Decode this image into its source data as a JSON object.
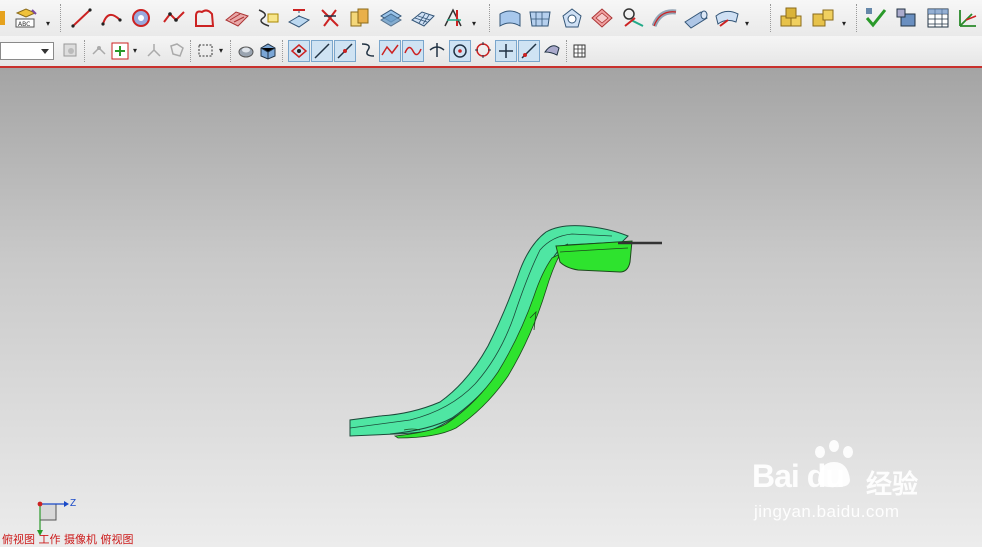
{
  "toolbar_top": {
    "groups": [
      {
        "icons": [
          "shade-icon",
          "text-style-icon"
        ]
      },
      {
        "icons": [
          "line-icon",
          "arc-icon",
          "circle-sweep-icon",
          "point-set-icon",
          "offset-curve-icon",
          "ruled-surface-icon",
          "section-curve-icon",
          "project-curve-icon",
          "bridge-curve-icon",
          "swept-curve-icon",
          "extract-icon",
          "mesh-surface-icon",
          "through-curves-icon"
        ]
      },
      {
        "icons": [
          "studio-surface-icon",
          "grid-surface-icon",
          "n-sided-icon",
          "styled-blend-icon",
          "law-extension-icon",
          "face-blend-icon",
          "tube-icon",
          "wrap-icon"
        ]
      },
      {
        "icons": [
          "assembly-icon",
          "component-icon"
        ]
      },
      {
        "icons": [
          "check-geometry-icon",
          "analysis-icon",
          "spreadsheet-icon",
          "wcs-icon"
        ]
      }
    ]
  },
  "toolbar_bottom": {
    "filter_value": "",
    "snap_icons": [
      "snap-endpoint-icon",
      "snap-midpoint-icon",
      "snap-control-icon",
      "snap-intersection-icon",
      "snap-arc-center-icon",
      "snap-quadrant-icon",
      "snap-existing-icon",
      "snap-on-curve-icon",
      "snap-on-face-icon"
    ]
  },
  "status_bar": {
    "text": "俯视图 工作 摄像机 俯视图"
  },
  "triad": {
    "axis_label": "Z"
  },
  "watermark": {
    "logo_text": "Bai du",
    "cn_text": "经验",
    "url": "jingyan.baidu.com"
  },
  "colors": {
    "accent": "#c8302c",
    "part_green": "#2ee32e",
    "part_light": "#4de0a0"
  }
}
